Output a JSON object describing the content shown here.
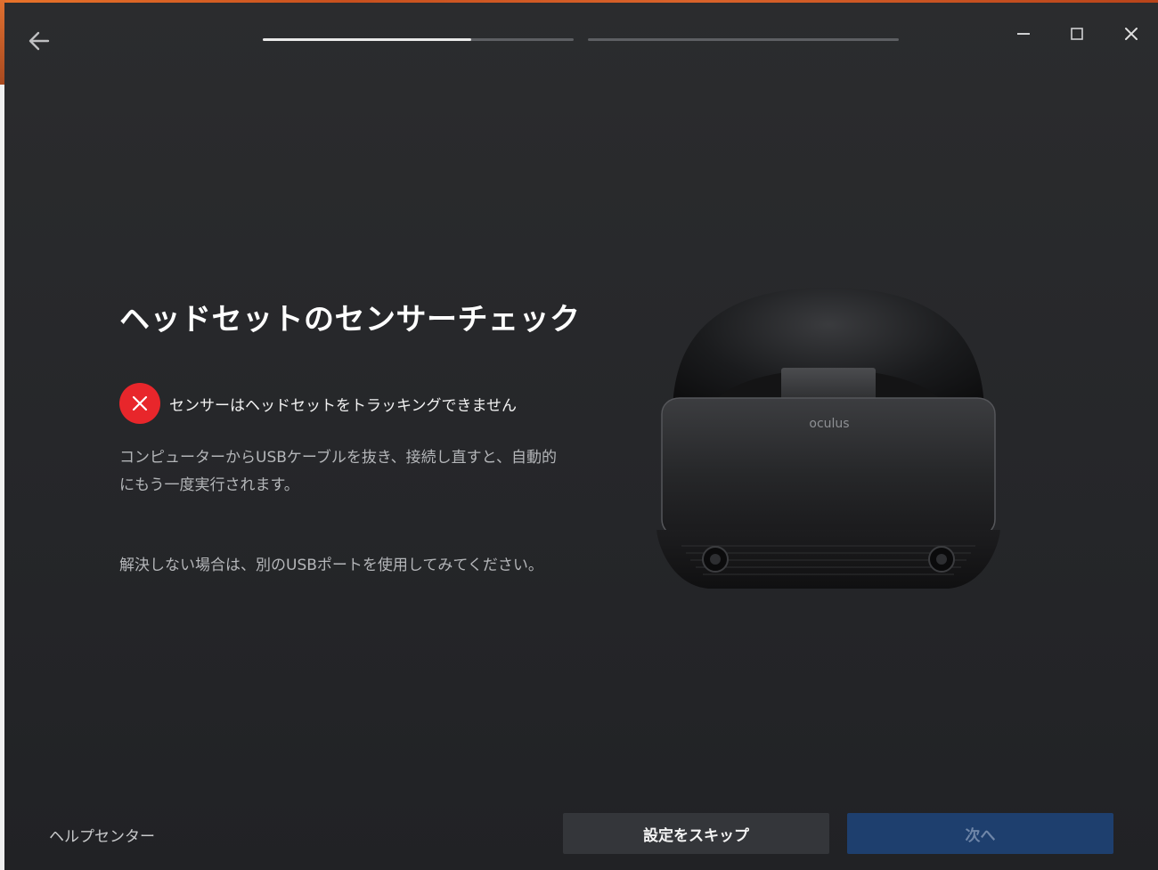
{
  "window": {
    "controls": {
      "minimize_icon": "minimize-icon",
      "maximize_icon": "maximize-icon",
      "close_icon": "close-icon"
    }
  },
  "progress": {
    "steps": [
      {
        "fill": 0.67
      },
      {
        "fill": 0.0
      }
    ]
  },
  "main": {
    "title": "ヘッドセットのセンサーチェック",
    "status": {
      "icon": "error-x-icon",
      "color": "#e8262b",
      "text": "センサーはヘッドセットをトラッキングできません"
    },
    "description": "コンピューターからUSBケーブルを抜き、接続し直すと、自動的にもう一度実行されます。",
    "hint": "解決しない場合は、別のUSBポートを使用してみてください。",
    "image": {
      "brand_label": "oculus"
    }
  },
  "footer": {
    "help_label": "ヘルプセンター",
    "skip_label": "設定をスキップ",
    "next_label": "次へ"
  },
  "colors": {
    "background": "#26272a",
    "error": "#e8262b",
    "next_button": "#1e3f6e"
  }
}
